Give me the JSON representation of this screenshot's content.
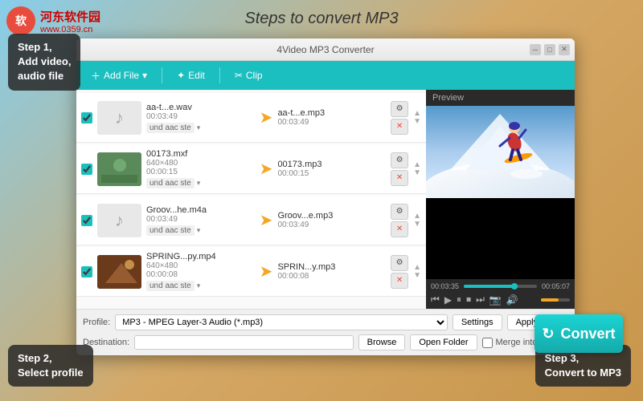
{
  "watermark": {
    "logo": "软",
    "site": "河东软件园",
    "url": "www.0359.cn"
  },
  "page_title": "Steps to convert MP3",
  "steps": {
    "step1": "Step 1,\nAdd video,\naudio file",
    "step2": "Step 2,\nSelect profile",
    "step3": "Step 3,\nConvert to MP3"
  },
  "app_window": {
    "title": "4Video MP3 Converter",
    "toolbar": {
      "add_file": "Add File",
      "edit": "Edit",
      "clip": "Clip"
    },
    "files": [
      {
        "checked": true,
        "thumb_type": "audio",
        "source_name": "aa-t...e.wav",
        "source_time": "00:03:49",
        "output_name": "aa-t...e.mp3",
        "output_time": "00:03:49",
        "format": "und aac ste"
      },
      {
        "checked": true,
        "thumb_type": "video1",
        "source_name": "00173.mxf",
        "source_res": "640×480",
        "source_time": "00:00:15",
        "output_name": "00173.mp3",
        "output_time": "00:00:15",
        "format": "und aac ste"
      },
      {
        "checked": true,
        "thumb_type": "video2",
        "source_name": "Groov...he.m4a",
        "source_time": "00:03:49",
        "output_name": "Groov...e.mp3",
        "output_time": "00:03:49",
        "format": "und aac ste"
      },
      {
        "checked": true,
        "thumb_type": "video3",
        "source_name": "SPRING...py.mp4",
        "source_res": "640×480",
        "source_time": "00:00:08",
        "output_name": "SPRIN...y.mp3",
        "output_time": "00:00:08",
        "format": "und aac ste"
      }
    ],
    "preview": {
      "label": "Preview",
      "time_current": "00:03:35",
      "time_total": "00:05:07"
    },
    "bottom": {
      "profile_label": "Profile:",
      "profile_value": "MP3 - MPEG Layer-3 Audio (*.mp3)",
      "settings_btn": "Settings",
      "apply_all_btn": "Apply to All",
      "dest_label": "Destination:",
      "browse_btn": "Browse",
      "open_folder_btn": "Open Folder",
      "merge_label": "Merge into one file"
    },
    "convert_btn": "Convert"
  }
}
